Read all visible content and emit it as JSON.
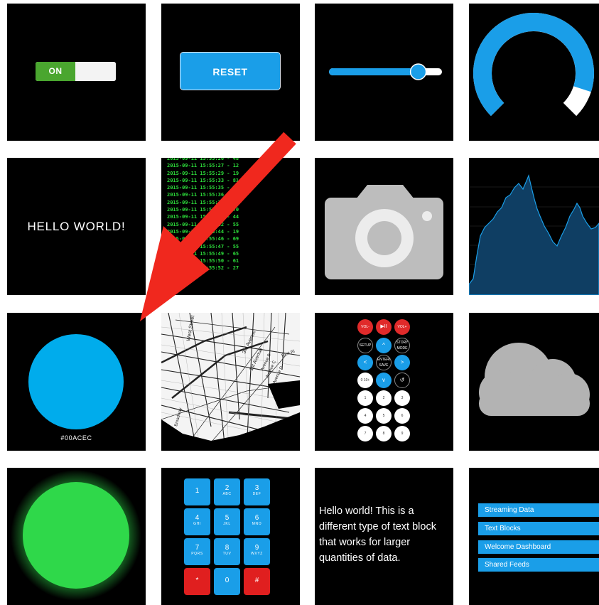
{
  "toggle": {
    "label": "ON",
    "state": "on",
    "on_color": "#4aa62f"
  },
  "reset": {
    "label": "RESET",
    "color": "#1a9ee8"
  },
  "slider": {
    "value": 0.79,
    "color": "#1a9ee8"
  },
  "gauge": {
    "value": 0.9,
    "color": "#1a9ee8"
  },
  "hello": {
    "text": "HELLO WORLD!"
  },
  "log": {
    "lines": [
      "2015-09-11 15:55:26 - 48",
      "2015-09-11 15:55:27 - 12",
      "2015-09-11 15:55:29 - 19",
      "2015-09-11 15:55:33 - 81",
      "2015-09-11 15:55:35 - 38",
      "2015-09-11 15:55:36 - 60",
      "2015-09-11 15:55:38 - 37",
      "2015-09-11 15:55:40 - 70",
      "2015-09-11 15:55:41 - 44",
      "2015-09-11 15:55:42 - 55",
      "2015-09-11 15:55:44 - 19",
      "2015-09-11 15:55:46 - 69",
      "2015-09-11 15:55:47 - 55",
      "2015-09-11 15:55:49 - 65",
      "2015-09-11 15:55:50 - 61",
      "2015-09-11 15:55:52 - 27"
    ]
  },
  "camera": {
    "icon": "camera-icon"
  },
  "area_chart": {
    "color": "#1a9ee8"
  },
  "color_widget": {
    "hex": "#00ACEC"
  },
  "map": {
    "icon": "map-tile"
  },
  "remote": {
    "vol_minus": "VOL-",
    "play_pause": "▶II",
    "vol_plus": "VOL+",
    "setup": "SETUP",
    "up": "^",
    "story_mode": "STORY MODE",
    "left": "<",
    "enter_save": "ENTER/ SAVE",
    "right": ">",
    "zero_ten": "0 10+",
    "down": "v",
    "back": "↺",
    "digits": [
      "1",
      "2",
      "3",
      "4",
      "5",
      "6",
      "7",
      "8",
      "9"
    ]
  },
  "cloud": {
    "icon": "cloud-icon"
  },
  "status_light": {
    "color": "#2fd84a"
  },
  "keypad": {
    "keys": [
      {
        "digit": "1",
        "letters": ""
      },
      {
        "digit": "2",
        "letters": "ABC"
      },
      {
        "digit": "3",
        "letters": "DEF"
      },
      {
        "digit": "4",
        "letters": "GHI"
      },
      {
        "digit": "5",
        "letters": "JKL"
      },
      {
        "digit": "6",
        "letters": "MNO"
      },
      {
        "digit": "7",
        "letters": "PQRS"
      },
      {
        "digit": "8",
        "letters": "TUV"
      },
      {
        "digit": "9",
        "letters": "WXYZ"
      },
      {
        "digit": "*",
        "letters": ""
      },
      {
        "digit": "0",
        "letters": ""
      },
      {
        "digit": "#",
        "letters": ""
      }
    ]
  },
  "text_block": {
    "text": "Hello world! This is a different type of text block that works for larger quantities of data."
  },
  "feeds": {
    "items": [
      "Streaming Data",
      "Text Blocks",
      "Welcome Dashboard",
      "Shared Feeds"
    ]
  },
  "map_labels": {
    "west_street": "West Street",
    "third_ave": "3rd Avenue",
    "first_ave": "1st Avenue",
    "ave_b": "Avenue B",
    "ave_c": "Avenue C",
    "ave_d": "Avenue D",
    "east_river": "East Ri",
    "broadway": "Broadway"
  },
  "arrow": {
    "color": "#f0281e"
  }
}
